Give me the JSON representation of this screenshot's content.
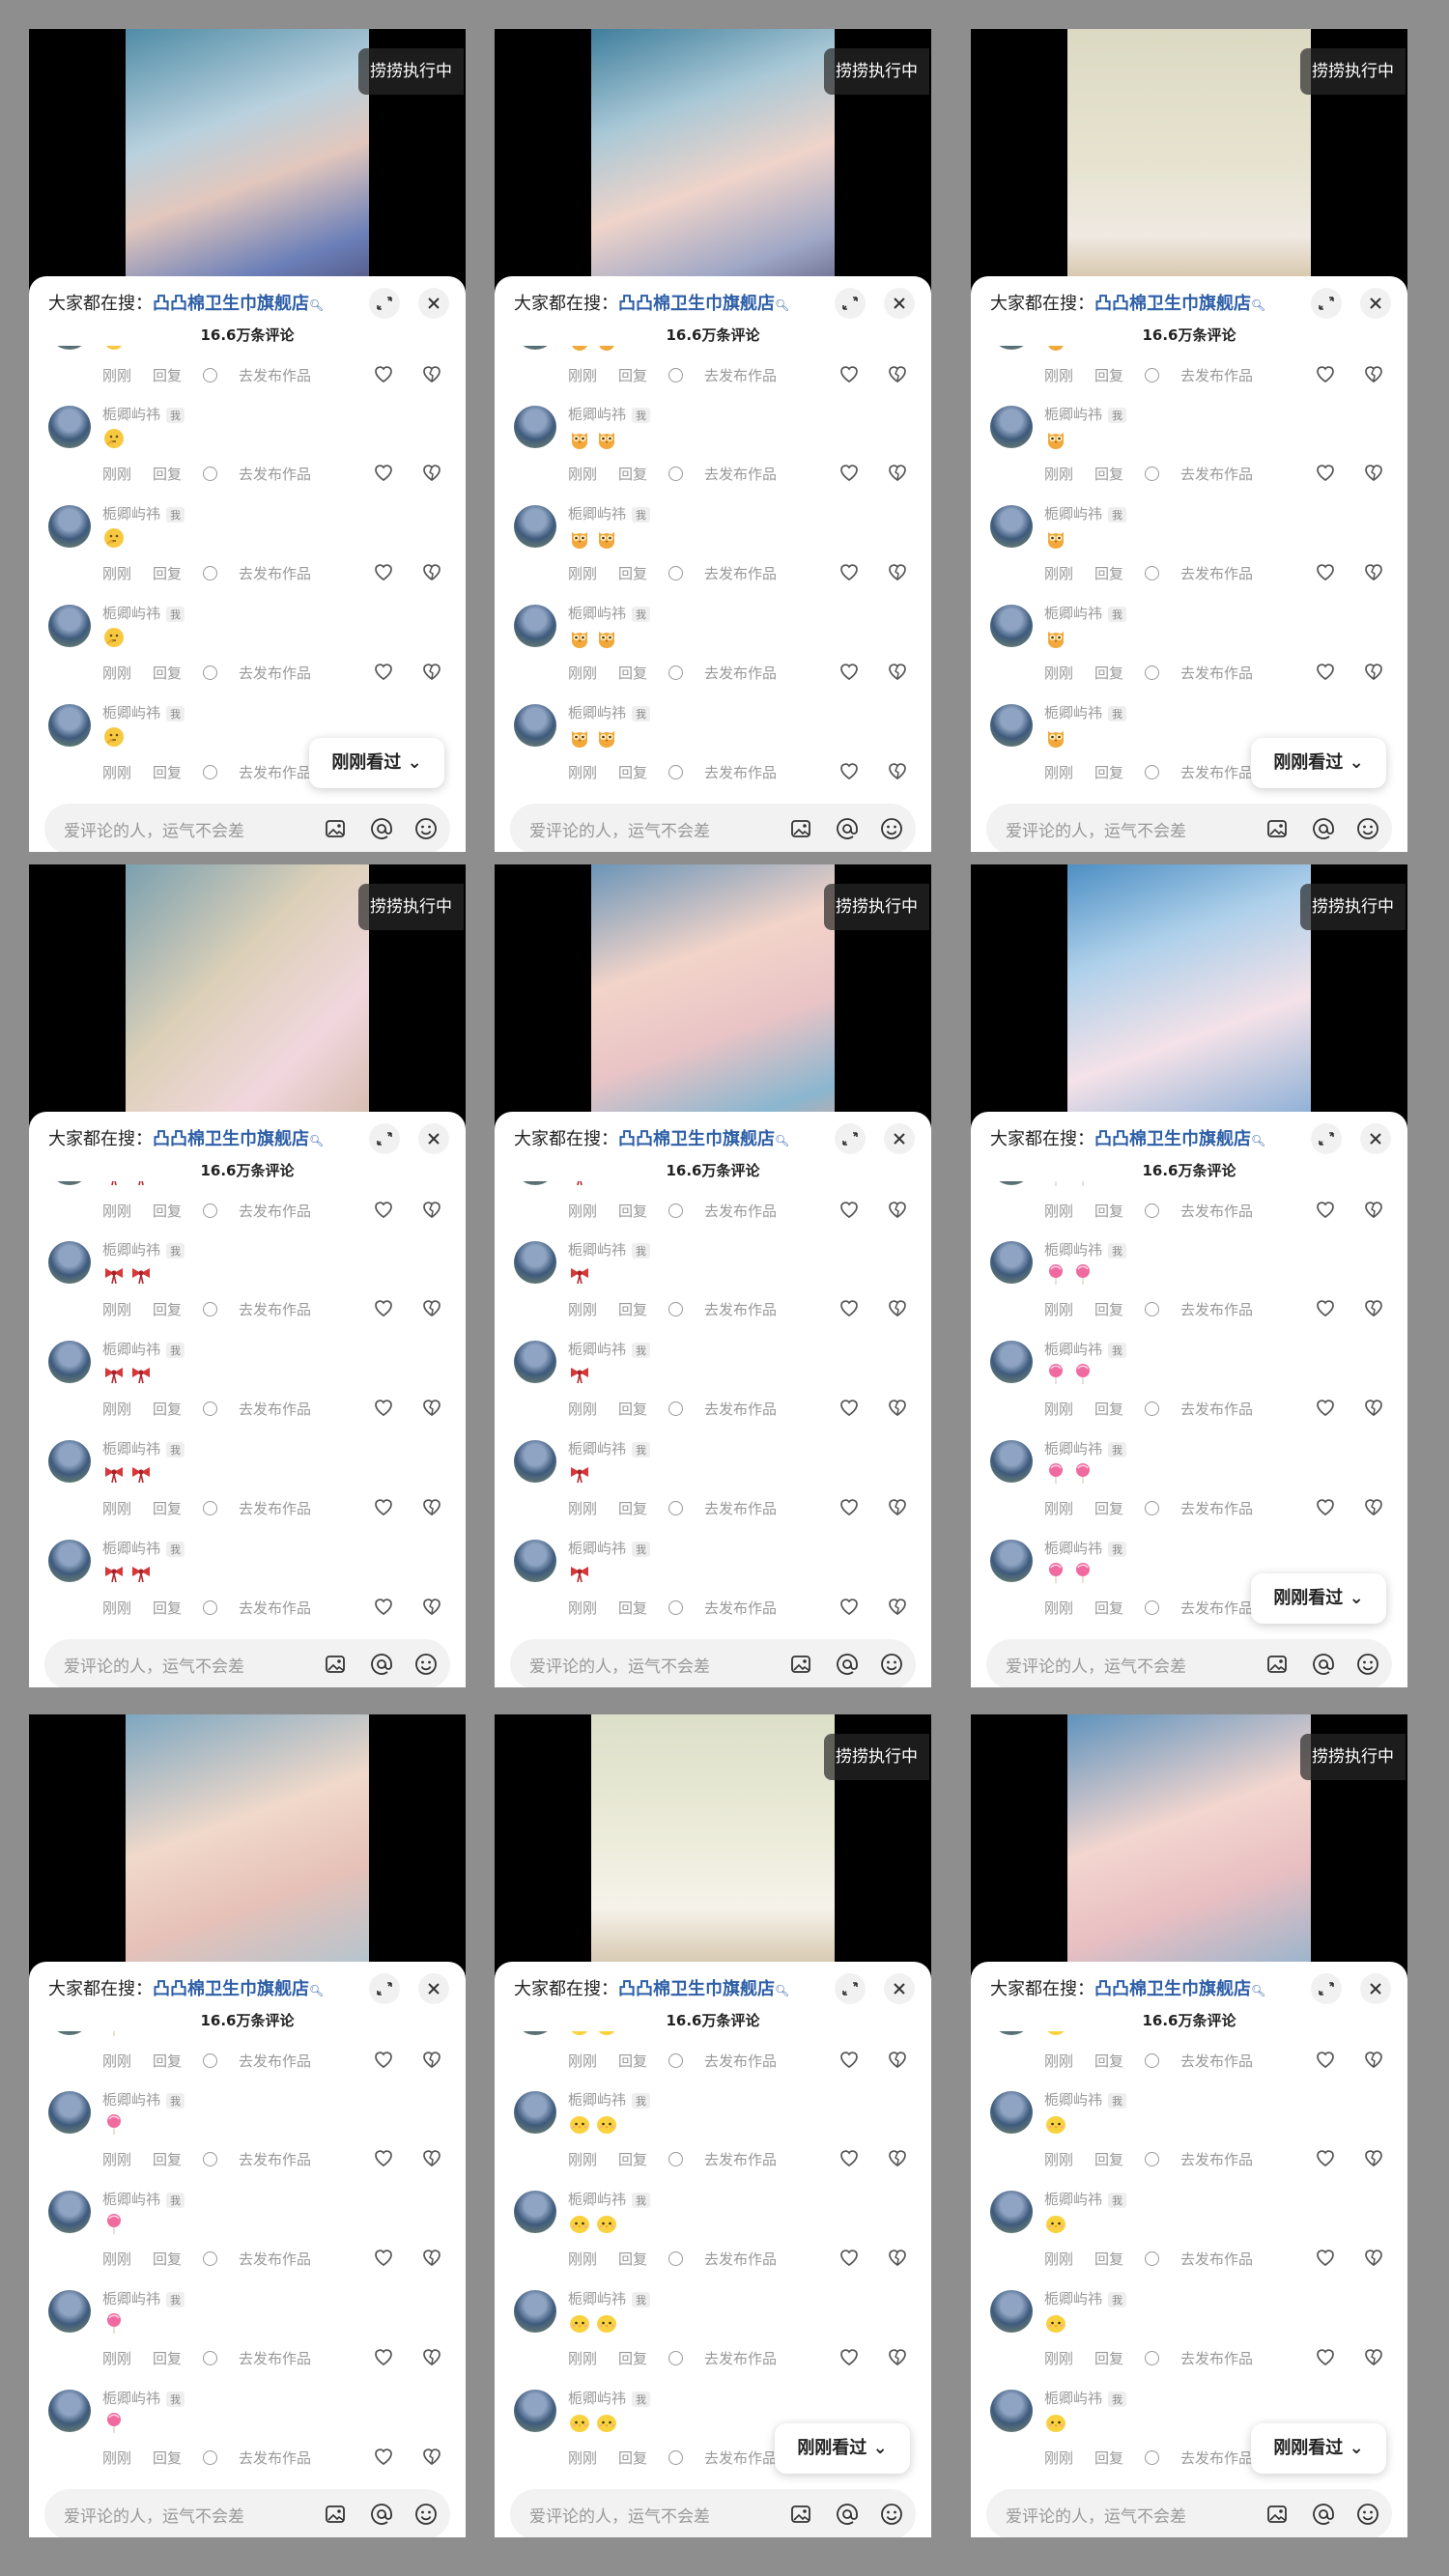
{
  "common": {
    "badge": "捞捞执行中",
    "search_prefix": "大家都在搜：",
    "search_keyword": "凸凸棉卫生巾旗舰店",
    "comment_count": "16.6万条评论",
    "username": "栀卿屿祎",
    "me_tag": "我",
    "time": "刚刚",
    "reply": "回复",
    "publish": "去发布作品",
    "seen_button": "刚刚看过",
    "input_placeholder": "爱评论的人，运气不会差",
    "icons": [
      "search-icon",
      "expand-icon",
      "close-icon",
      "heart-icon",
      "dislike-icon",
      "image-icon",
      "at-icon",
      "emoji-icon",
      "chevron-down-icon"
    ]
  },
  "panels": [
    {
      "video": "portrait-blue-dress",
      "emoji": "thinking-face",
      "emoji_count": 1,
      "show_seen": true,
      "show_badge": true
    },
    {
      "video": "portrait-blue-dress-closeup",
      "emoji": "owl-face",
      "emoji_count": 2,
      "show_seen": false,
      "show_badge": true
    },
    {
      "video": "girl-painting-easel",
      "emoji": "owl-face",
      "emoji_count": 1,
      "show_seen": true,
      "show_badge": true
    },
    {
      "video": "painted-canvas-room",
      "emoji": "candy-bow",
      "emoji_count": 2,
      "show_seen": false,
      "show_badge": true
    },
    {
      "video": "lucky-cat-painting",
      "emoji": "candy-bow",
      "emoji_count": 1,
      "show_seen": false,
      "show_badge": true
    },
    {
      "video": "lucky-cat-blue-wall",
      "emoji": "lollipop",
      "emoji_count": 2,
      "show_seen": true,
      "show_badge": true
    },
    {
      "video": "lucky-cat-on-easel",
      "emoji": "lollipop",
      "emoji_count": 1,
      "show_seen": false,
      "show_badge": false
    },
    {
      "video": "girl-palette-white-dress",
      "emoji": "chick-face",
      "emoji_count": 2,
      "show_seen": true,
      "show_badge": true
    },
    {
      "video": "lucky-cat-painting-brush",
      "emoji": "chick-face",
      "emoji_count": 1,
      "show_seen": true,
      "show_badge": true
    }
  ],
  "colors": {
    "accent": "#2e5fa8",
    "background": "#8e8e8e",
    "sheet": "#ffffff",
    "muted_text": "#999999"
  }
}
